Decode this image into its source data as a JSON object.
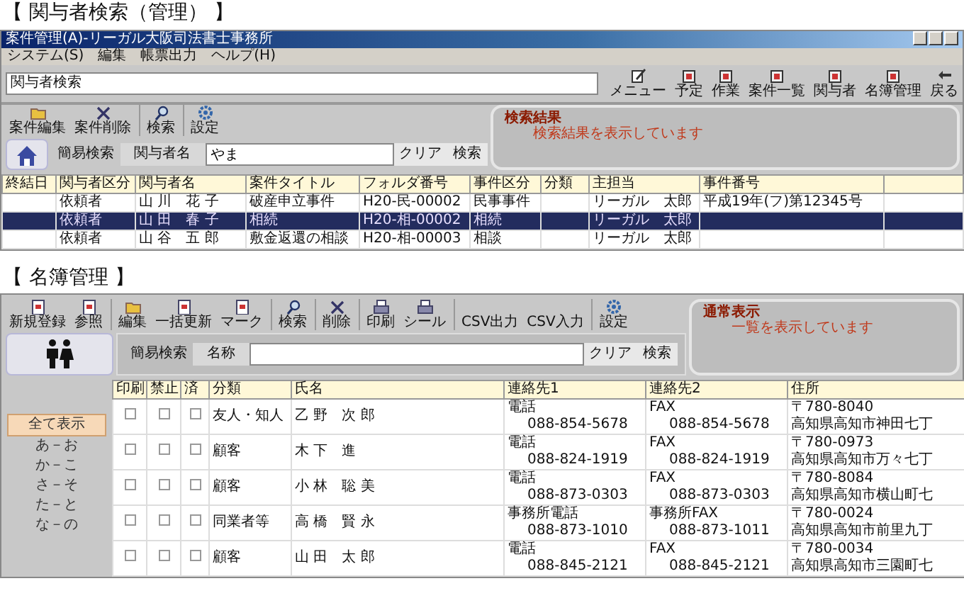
{
  "search_section": {
    "heading": "【 関与者検索（管理） 】",
    "window": {
      "title": "案件管理(A)-リーガル大阪司法書士事務所",
      "menu": [
        "システム(S)",
        "編集",
        "帳票出力",
        "ヘルプ(H)"
      ],
      "screen_field": "関与者検索",
      "nav_buttons": [
        "メニュー",
        "予定",
        "作業",
        "案件一覧",
        "関与者",
        "名簿管理",
        "戻る"
      ],
      "toolbar": [
        "案件編集",
        "案件削除",
        "検索",
        "設定"
      ],
      "quick_search": {
        "label": "簡易検索",
        "field_label": "関与者名",
        "value": "やま",
        "buttons": [
          "クリア",
          "検索"
        ]
      },
      "result_panel": {
        "title": "検索結果",
        "message": "検索結果を表示しています"
      },
      "table": {
        "columns": [
          "終結日",
          "関与者区分",
          "関与者名",
          "案件タイトル",
          "フォルダ番号",
          "事件区分",
          "分類",
          "主担当",
          "事件番号",
          ""
        ],
        "rows": [
          {
            "selected": false,
            "cells": [
              "",
              "依頼者",
              "山 川　花 子",
              "破産申立事件",
              "H20-民-00002",
              "民事事件",
              "",
              "リーガル　太郎",
              "平成19年(フ)第12345号"
            ]
          },
          {
            "selected": true,
            "cells": [
              "",
              "依頼者",
              "山 田　春 子",
              "相続",
              "H20-相-00002",
              "相続",
              "",
              "リーガル　太郎",
              ""
            ]
          },
          {
            "selected": false,
            "cells": [
              "",
              "依頼者",
              "山 谷　五 郎",
              "敷金返還の相談",
              "H20-相-00003",
              "相談",
              "",
              "リーガル　太郎",
              ""
            ]
          }
        ]
      }
    }
  },
  "directory_section": {
    "heading": "【 名簿管理 】",
    "window": {
      "toolbar": [
        "新規登録",
        "参照",
        "編集",
        "一括更新",
        "マーク",
        "検索",
        "削除",
        "印刷",
        "シール",
        "CSV出力",
        "CSV入力",
        "設定"
      ],
      "status_panel": {
        "title": "通常表示",
        "message": "一覧を表示しています"
      },
      "quick_search": {
        "label": "簡易検索",
        "field_label": "名称",
        "buttons": [
          "クリア",
          "検索"
        ]
      },
      "sidebar": {
        "items": [
          {
            "label": "全て表示",
            "selected": true
          },
          {
            "label": "あ－お",
            "selected": false
          },
          {
            "label": "か－こ",
            "selected": false
          },
          {
            "label": "さ－そ",
            "selected": false
          },
          {
            "label": "た－と",
            "selected": false
          },
          {
            "label": "な－の",
            "selected": false
          }
        ]
      },
      "table": {
        "columns": [
          "印刷",
          "禁止",
          "済",
          "分類",
          "氏名",
          "連絡先1",
          "連絡先2",
          "住所"
        ],
        "rows": [
          {
            "print": false,
            "blocked": false,
            "done": false,
            "category": "友人・知人",
            "name": "乙 野　次 郎",
            "contact1_type": "電話",
            "contact1": "088-854-5678",
            "contact2_type": "FAX",
            "contact2": "088-854-5678",
            "postal": "〒780-8040",
            "address": "高知県高知市神田七丁"
          },
          {
            "print": false,
            "blocked": false,
            "done": false,
            "category": "顧客",
            "name": "木 下　進",
            "contact1_type": "電話",
            "contact1": "088-824-1919",
            "contact2_type": "FAX",
            "contact2": "088-824-1919",
            "postal": "〒780-0973",
            "address": "高知県高知市万々七丁"
          },
          {
            "print": false,
            "blocked": false,
            "done": false,
            "category": "顧客",
            "name": "小 林　聡 美",
            "contact1_type": "電話",
            "contact1": "088-873-0303",
            "contact2_type": "FAX",
            "contact2": "088-873-0303",
            "postal": "〒780-8084",
            "address": "高知県高知市横山町七"
          },
          {
            "print": false,
            "blocked": false,
            "done": false,
            "category": "同業者等",
            "name": "高 橋　賢 永",
            "contact1_type": "事務所電話",
            "contact1": "088-873-1010",
            "contact2_type": "事務所FAX",
            "contact2": "088-873-1011",
            "postal": "〒780-0024",
            "address": "高知県高知市前里九丁"
          },
          {
            "print": false,
            "blocked": false,
            "done": false,
            "category": "顧客",
            "name": "山 田　太 郎",
            "contact1_type": "電話",
            "contact1": "088-845-2121",
            "contact2_type": "FAX",
            "contact2": "088-845-2121",
            "postal": "〒780-0034",
            "address": "高知県高知市三園町七"
          }
        ]
      }
    }
  }
}
